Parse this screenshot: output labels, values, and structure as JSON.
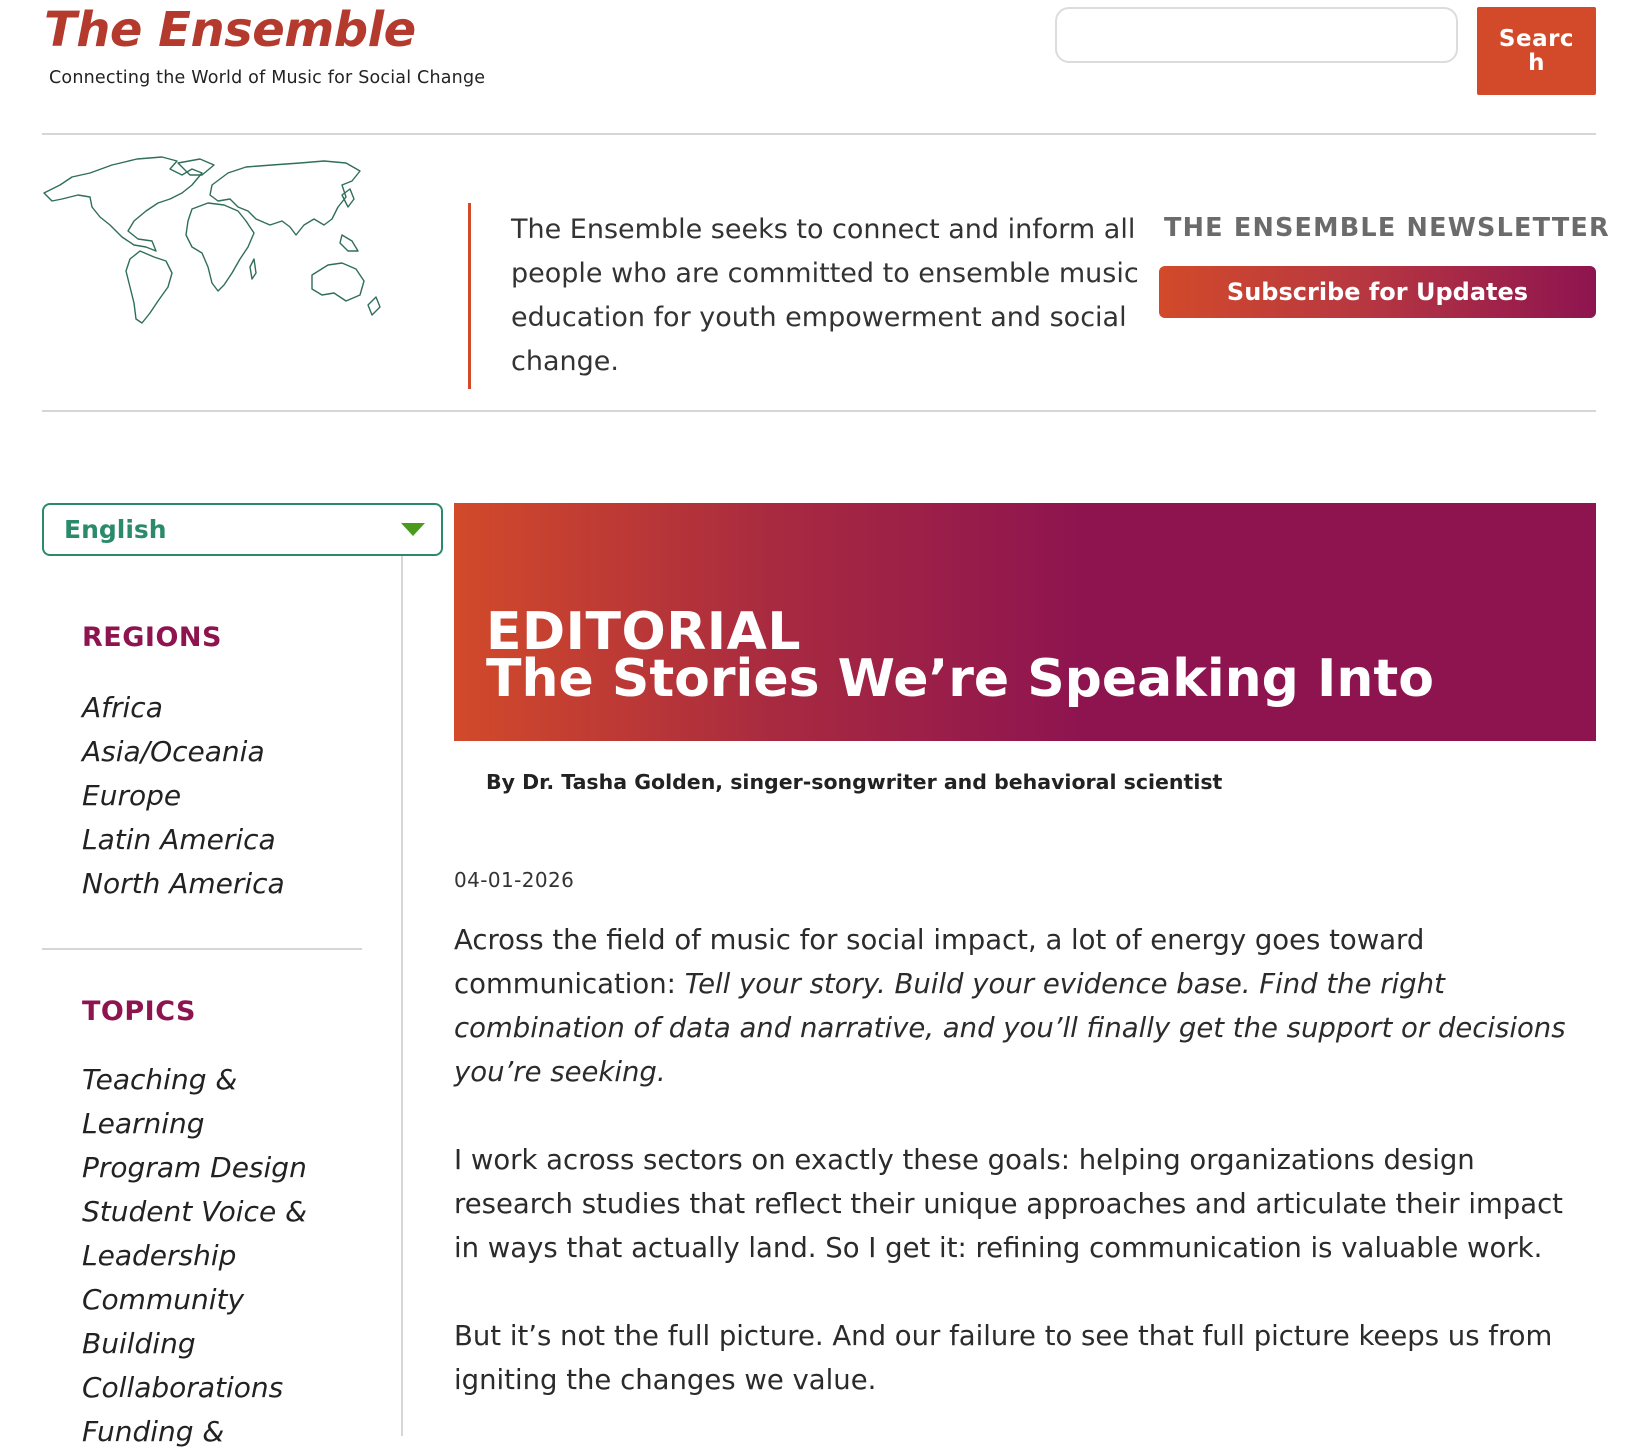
{
  "header": {
    "logo": "The Ensemble",
    "tagline": "Connecting the World of Music for Social Change",
    "search": {
      "placeholder": "",
      "button_label": "Search"
    }
  },
  "intro": {
    "mission": "The Ensemble seeks to connect and inform all people who are committed to ensemble music education for youth empowerment and social change.",
    "newsletter_title": "THE ENSEMBLE NEWSLETTER",
    "newsletter_button": "Subscribe for Updates"
  },
  "sidebar": {
    "language": "English",
    "regions_heading": "REGIONS",
    "regions": [
      "Africa",
      "Asia/Oceania",
      "Europe",
      "Latin America",
      "North America"
    ],
    "topics_heading": "TOPICS",
    "topics": [
      "Teaching & Learning",
      "Program Design",
      "Student Voice & Leadership",
      "Community Building",
      "Collaborations",
      "Funding &"
    ]
  },
  "article": {
    "kicker": "EDITORIAL",
    "title": "The Stories We’re Speaking Into",
    "byline": "By Dr. Tasha Golden, singer-songwriter and behavioral scientist",
    "date": "04-01-2026",
    "p1_lead": "Across the field of music for social impact, a lot of energy goes toward communication: ",
    "p1_quote": "Tell your story. Build your evidence base. Find the right combination of data and narrative, and you’ll finally get the support or decisions you’re seeking.",
    "p2": "I work across sectors on exactly these goals: helping organizations design research studies that reflect their unique approaches and articulate their impact in ways that actually land. So I get it: refining communication is valuable work.",
    "p3": "But it’s not the full picture. And our failure to see that full picture keeps us from igniting the changes we value."
  },
  "colors": {
    "brand_red": "#d24a2a",
    "brand_magenta": "#8e1450",
    "accent_green": "#2a8a6a"
  }
}
